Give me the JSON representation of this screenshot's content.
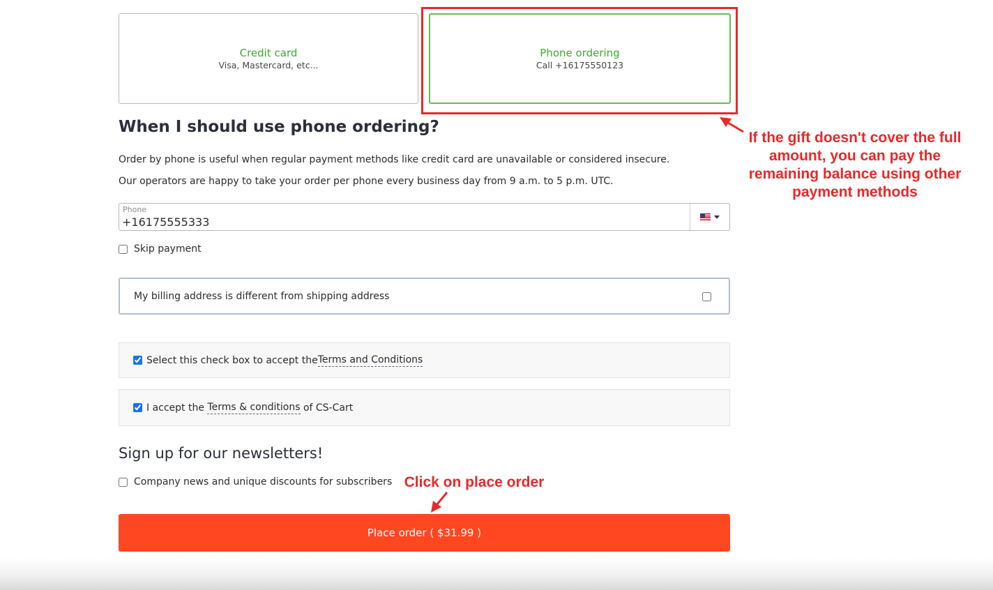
{
  "payment_methods": [
    {
      "title": "Credit card",
      "subtitle": "Visa, Mastercard, etc..."
    },
    {
      "title": "Phone ordering",
      "subtitle": "Call +16175550123"
    }
  ],
  "section": {
    "title": "When I should use phone ordering?",
    "paragraphs": [
      "Order by phone is useful when regular payment methods like credit card are unavailable or considered insecure.",
      "Our operators are happy to take your order per phone every business day from 9 a.m. to 5 p.m. UTC."
    ]
  },
  "phone": {
    "label": "Phone",
    "value": "+16175555333",
    "country_icon": "us-flag-icon"
  },
  "skip_payment": {
    "label": "Skip payment",
    "checked": false
  },
  "billing": {
    "label": "My billing address is different from shipping address",
    "checked": false
  },
  "terms": [
    {
      "before": "Select this check box to accept the ",
      "link": "Terms and Conditions",
      "after": "",
      "checked": true
    },
    {
      "before": "I accept the ",
      "link": "Terms & conditions",
      "after": " of CS-Cart",
      "checked": true
    }
  ],
  "newsletter": {
    "title": "Sign up for our newsletters!",
    "option_label": "Company news and unique discounts for subscribers",
    "checked": false
  },
  "place_order": {
    "label": "Place order ( $31.99 )"
  },
  "annotations": {
    "gift_note": "If the gift doesn't cover the full amount, you can pay the remaining balance using other payment methods",
    "click_note": "Click on place order",
    "color": "#e8282a"
  },
  "colors": {
    "accent_green": "#3fa933",
    "button": "#ff4722"
  }
}
